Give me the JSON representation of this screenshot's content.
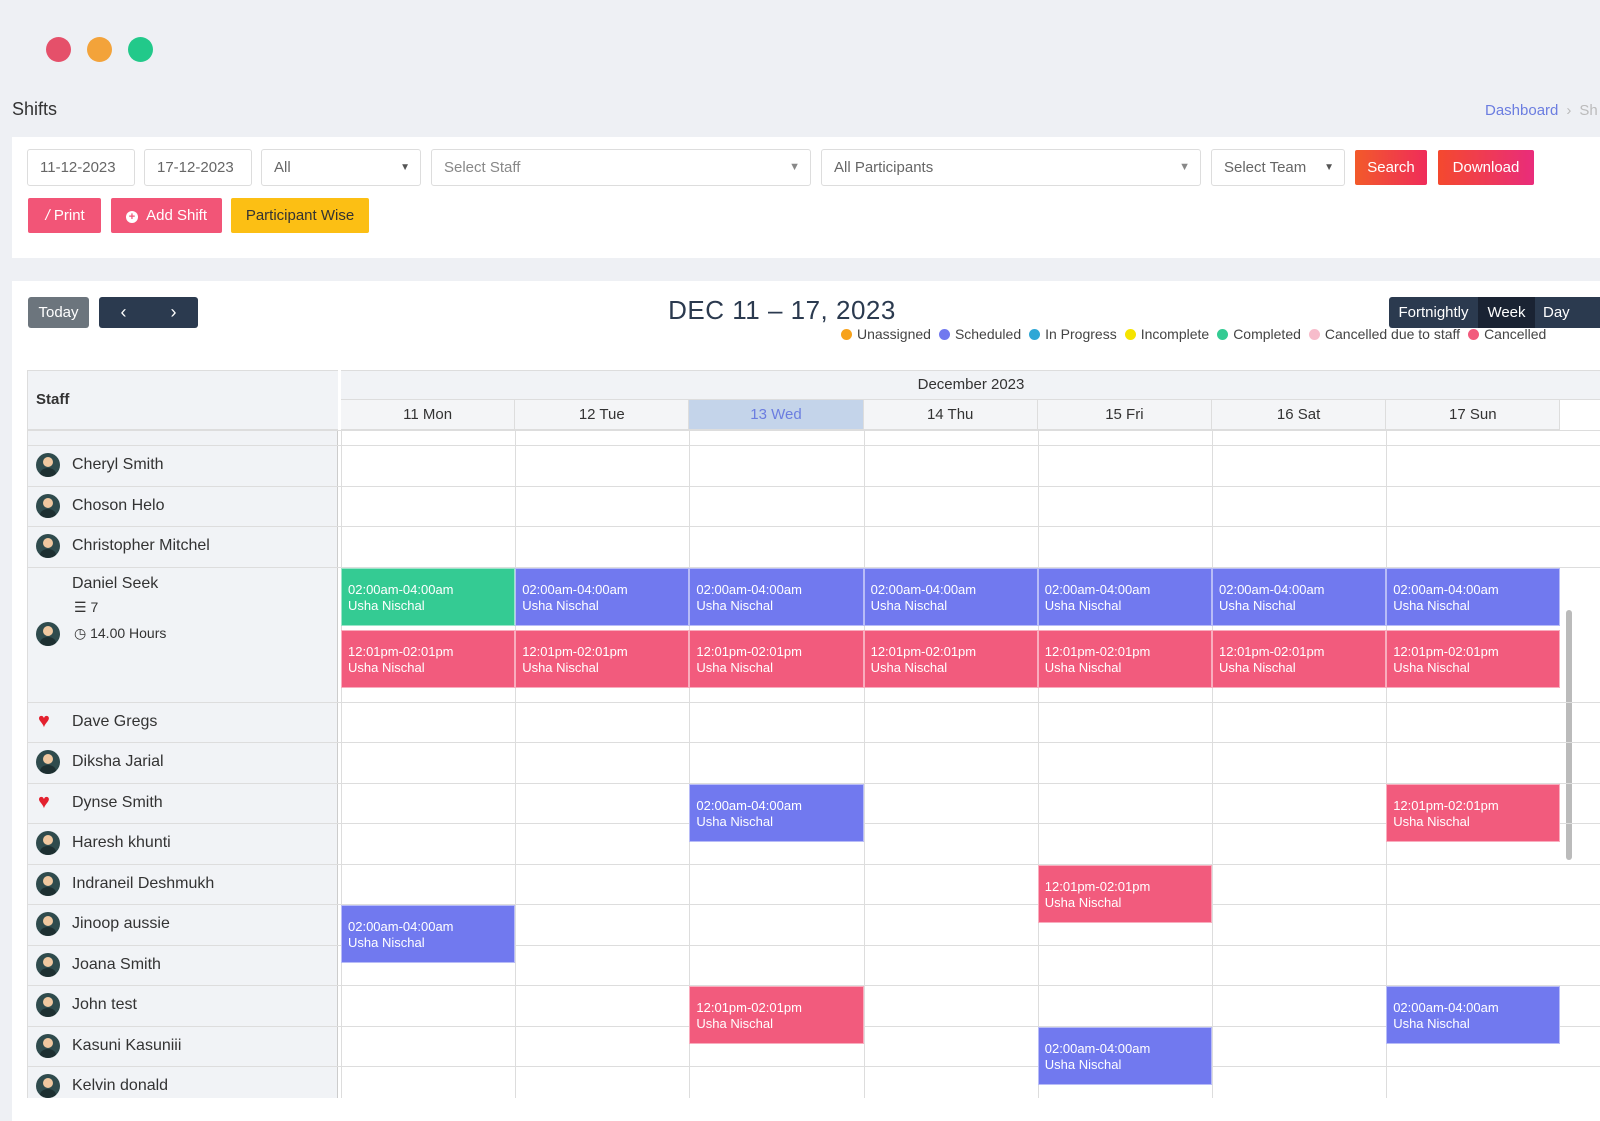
{
  "window": {
    "colors": {
      "close": "#e5506a",
      "minimize": "#f3a33a",
      "maximize": "#22c98a"
    }
  },
  "page": {
    "title": "Shifts"
  },
  "breadcrumb": {
    "home": "Dashboard",
    "separator": "›",
    "current": "Sh"
  },
  "filters": {
    "start_date": "11-12-2023",
    "end_date": "17-12-2023",
    "type_select": "All",
    "staff_placeholder": "Select Staff",
    "participants": "All Participants",
    "team_placeholder": "Select Team",
    "search_label": "Search",
    "download_label": "Download",
    "print_label": " Print",
    "add_shift_label": "Add Shift",
    "participant_wise_label": "Participant Wise"
  },
  "calendar": {
    "today_label": "Today",
    "prev_icon": "chevron-left-icon",
    "next_icon": "chevron-right-icon",
    "title": "DEC 11 – 17, 2023",
    "views": {
      "fortnightly": "Fortnightly",
      "week": "Week",
      "day": "Day"
    },
    "active_view": "Week",
    "legend": [
      {
        "label": "Unassigned",
        "color": "#f7a21b"
      },
      {
        "label": "Scheduled",
        "color": "#7179ef"
      },
      {
        "label": "In Progress",
        "color": "#2fa7d6"
      },
      {
        "label": "Incomplete",
        "color": "#f5e400"
      },
      {
        "label": "Completed",
        "color": "#34cb93"
      },
      {
        "label": "Cancelled due to staff",
        "color": "#f7bccb"
      },
      {
        "label": "Cancelled",
        "color": "#f25b7d"
      }
    ],
    "staff_header": "Staff",
    "month_header": "December 2023",
    "days": [
      {
        "num": "11",
        "name": "Mon"
      },
      {
        "num": "12",
        "name": "Tue"
      },
      {
        "num": "13",
        "name": "Wed",
        "today": true
      },
      {
        "num": "14",
        "name": "Thu"
      },
      {
        "num": "15",
        "name": "Fri"
      },
      {
        "num": "16",
        "name": "Sat"
      },
      {
        "num": "17",
        "name": "Sun"
      }
    ],
    "staff": [
      {
        "name": "Cheryl Smith"
      },
      {
        "name": "Choson Helo"
      },
      {
        "name": "Christopher Mitchel"
      },
      {
        "name": "Daniel Seek",
        "shift_count": "7",
        "hours": "14.00 Hours"
      },
      {
        "name": "Dave Gregs",
        "icon": "heart-icon"
      },
      {
        "name": "Diksha Jarial"
      },
      {
        "name": "Dynse Smith",
        "icon": "heart-icon"
      },
      {
        "name": "Haresh khunti"
      },
      {
        "name": "Indraneil Deshmukh"
      },
      {
        "name": "Jinoop aussie"
      },
      {
        "name": "Joana Smith"
      },
      {
        "name": "John test"
      },
      {
        "name": "Kasuni Kasuniii"
      },
      {
        "name": "Kelvin donald"
      }
    ],
    "shifts": [
      {
        "staff": "Daniel Seek",
        "day": "11",
        "time": "02:00am-04:00am",
        "participant": "Usha Nischal",
        "status": "Completed"
      },
      {
        "staff": "Daniel Seek",
        "day": "12",
        "time": "02:00am-04:00am",
        "participant": "Usha Nischal",
        "status": "Scheduled"
      },
      {
        "staff": "Daniel Seek",
        "day": "13",
        "time": "02:00am-04:00am",
        "participant": "Usha Nischal",
        "status": "Scheduled"
      },
      {
        "staff": "Daniel Seek",
        "day": "14",
        "time": "02:00am-04:00am",
        "participant": "Usha Nischal",
        "status": "Scheduled"
      },
      {
        "staff": "Daniel Seek",
        "day": "15",
        "time": "02:00am-04:00am",
        "participant": "Usha Nischal",
        "status": "Scheduled"
      },
      {
        "staff": "Daniel Seek",
        "day": "16",
        "time": "02:00am-04:00am",
        "participant": "Usha Nischal",
        "status": "Scheduled"
      },
      {
        "staff": "Daniel Seek",
        "day": "17",
        "time": "02:00am-04:00am",
        "participant": "Usha Nischal",
        "status": "Scheduled"
      },
      {
        "staff": "Daniel Seek",
        "day": "11",
        "time": "12:01pm-02:01pm",
        "participant": "Usha Nischal",
        "status": "Cancelled"
      },
      {
        "staff": "Daniel Seek",
        "day": "12",
        "time": "12:01pm-02:01pm",
        "participant": "Usha Nischal",
        "status": "Cancelled"
      },
      {
        "staff": "Daniel Seek",
        "day": "13",
        "time": "12:01pm-02:01pm",
        "participant": "Usha Nischal",
        "status": "Cancelled"
      },
      {
        "staff": "Daniel Seek",
        "day": "14",
        "time": "12:01pm-02:01pm",
        "participant": "Usha Nischal",
        "status": "Cancelled"
      },
      {
        "staff": "Daniel Seek",
        "day": "15",
        "time": "12:01pm-02:01pm",
        "participant": "Usha Nischal",
        "status": "Cancelled"
      },
      {
        "staff": "Daniel Seek",
        "day": "16",
        "time": "12:01pm-02:01pm",
        "participant": "Usha Nischal",
        "status": "Cancelled"
      },
      {
        "staff": "Daniel Seek",
        "day": "17",
        "time": "12:01pm-02:01pm",
        "participant": "Usha Nischal",
        "status": "Cancelled"
      },
      {
        "staff": "Dynse Smith",
        "day": "13",
        "time": "02:00am-04:00am",
        "participant": "Usha Nischal",
        "status": "Scheduled"
      },
      {
        "staff": "Dynse Smith",
        "day": "17",
        "time": "12:01pm-02:01pm",
        "participant": "Usha Nischal",
        "status": "Cancelled"
      },
      {
        "staff": "Indraneil Deshmukh",
        "day": "15",
        "time": "12:01pm-02:01pm",
        "participant": "Usha Nischal",
        "status": "Cancelled"
      },
      {
        "staff": "Jinoop aussie",
        "day": "11",
        "time": "02:00am-04:00am",
        "participant": "Usha Nischal",
        "status": "Scheduled"
      },
      {
        "staff": "John test",
        "day": "13",
        "time": "12:01pm-02:01pm",
        "participant": "Usha Nischal",
        "status": "Cancelled"
      },
      {
        "staff": "John test",
        "day": "17",
        "time": "02:00am-04:00am",
        "participant": "Usha Nischal",
        "status": "Scheduled"
      },
      {
        "staff": "Kasuni Kasuniii",
        "day": "15",
        "time": "02:00am-04:00am",
        "participant": "Usha Nischal",
        "status": "Scheduled"
      }
    ]
  }
}
